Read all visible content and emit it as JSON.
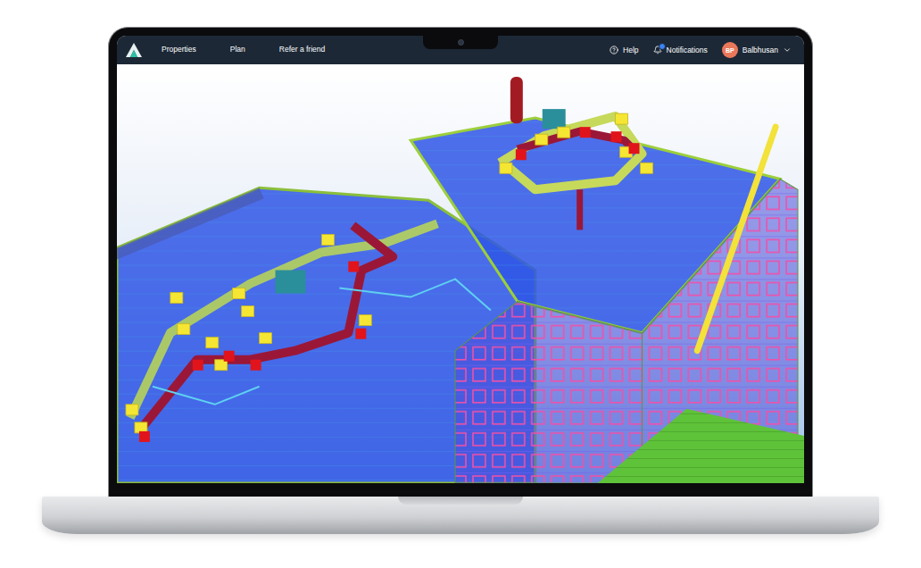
{
  "nav": {
    "items": [
      {
        "label": "Properties",
        "selected": false
      },
      {
        "label": "Plan",
        "selected": false
      },
      {
        "label": "Refer a friend",
        "selected": false
      }
    ]
  },
  "actions": [
    {
      "label": "Help",
      "kind": "help",
      "badge": false
    },
    {
      "label": "Notifications",
      "kind": "notifications",
      "badge": true
    }
  ],
  "user": {
    "initials": "BP",
    "name": "Balbhusan"
  }
}
